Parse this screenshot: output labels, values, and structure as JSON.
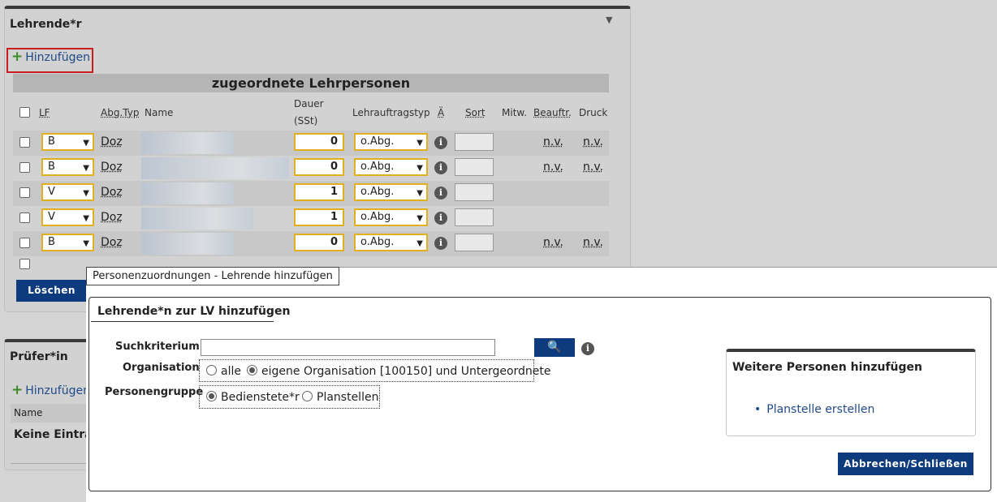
{
  "lehrende": {
    "title": "Lehrende*r",
    "collapse_glyph": "▼",
    "add_label": "Hinzufügen",
    "table_title": "zugeordnete Lehrpersonen",
    "columns": {
      "lf": "LF",
      "abg_typ": "Abg.Typ",
      "name": "Name",
      "dauer": "Dauer",
      "dauer_unit": "(SSt)",
      "lehrauftragstyp": "Lehrauftragstyp",
      "ae": "Ä",
      "sort": "Sort",
      "mitw": "Mitw.",
      "beauftr": "Beauftr.",
      "druck": "Druck"
    },
    "rows": [
      {
        "lf": "B",
        "abg": "Doz",
        "dauer": "0",
        "typ": "o.Abg.",
        "beauftr": "n.v.",
        "druck": "n.v."
      },
      {
        "lf": "B",
        "abg": "Doz",
        "dauer": "0",
        "typ": "o.Abg.",
        "beauftr": "n.v.",
        "druck": "n.v."
      },
      {
        "lf": "V",
        "abg": "Doz",
        "dauer": "1",
        "typ": "o.Abg.",
        "beauftr": "",
        "druck": ""
      },
      {
        "lf": "V",
        "abg": "Doz",
        "dauer": "1",
        "typ": "o.Abg.",
        "beauftr": "",
        "druck": ""
      },
      {
        "lf": "B",
        "abg": "Doz",
        "dauer": "0",
        "typ": "o.Abg.",
        "beauftr": "n.v.",
        "druck": "n.v."
      }
    ],
    "delete_label": "Löschen"
  },
  "pruefer": {
    "title": "Prüfer*in",
    "add_label": "Hinzufügen",
    "col_name": "Name",
    "empty": "Keine Einträg"
  },
  "dialog": {
    "title": "Personenzuordnungen - Lehrende hinzufügen",
    "box_title": "Lehrende*n zur LV hinzufügen",
    "suchkriterium_label": "Suchkriterium",
    "search_value": "",
    "search_icon": "🔍",
    "organisation_label": "Organisation",
    "org_options": [
      "alle",
      "eigene Organisation [100150] und Untergeordnete"
    ],
    "personengruppe_label": "Personengruppe",
    "group_options": [
      "Bedienstete*r",
      "Planstellen"
    ],
    "side_title": "Weitere Personen hinzufügen",
    "side_link": "Planstelle erstellen",
    "close_label": "Abbrechen/Schließen",
    "info_glyph": "i"
  }
}
